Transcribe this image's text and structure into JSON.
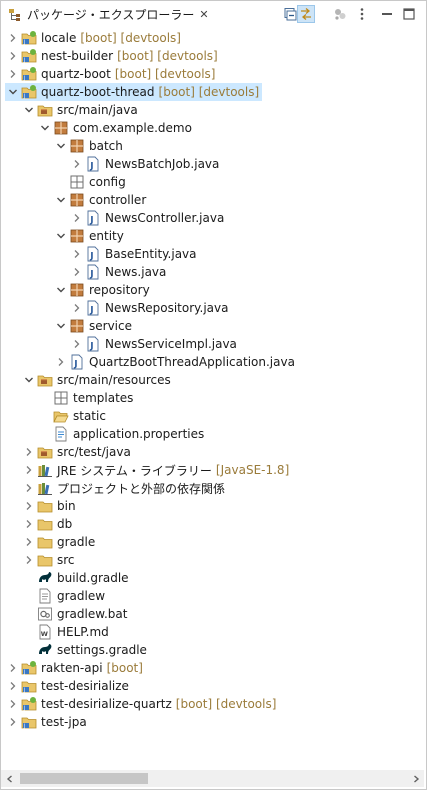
{
  "tab": {
    "title": "パッケージ・エクスプローラー",
    "close_glyph": "✕"
  },
  "toolbar": [
    {
      "name": "collapse-all-icon",
      "active": false
    },
    {
      "name": "link-with-editor-icon",
      "active": true
    },
    {
      "name": "focus-active-task-icon",
      "active": false
    },
    {
      "name": "view-menu-icon",
      "active": false
    },
    {
      "name": "minimize-icon",
      "active": false
    },
    {
      "name": "maximize-icon",
      "active": false
    }
  ],
  "tree": [
    {
      "level": 0,
      "twisty": "closed",
      "icon": "project-java-boot",
      "label": "locale",
      "dec": "[boot] [devtools]"
    },
    {
      "level": 0,
      "twisty": "closed",
      "icon": "project-java-boot",
      "label": "nest-builder",
      "dec": "[boot] [devtools]"
    },
    {
      "level": 0,
      "twisty": "closed",
      "icon": "project-java-boot",
      "label": "quartz-boot",
      "dec": "[boot] [devtools]"
    },
    {
      "level": 0,
      "twisty": "open",
      "icon": "project-java-boot",
      "label": "quartz-boot-thread",
      "dec": "[boot] [devtools]",
      "selected": true
    },
    {
      "level": 1,
      "twisty": "open",
      "icon": "source-folder",
      "label": "src/main/java"
    },
    {
      "level": 2,
      "twisty": "open",
      "icon": "package",
      "label": "com.example.demo"
    },
    {
      "level": 3,
      "twisty": "open",
      "icon": "package",
      "label": "batch"
    },
    {
      "level": 4,
      "twisty": "closed",
      "icon": "java-file",
      "label": "NewsBatchJob.java"
    },
    {
      "level": 3,
      "twisty": "none",
      "icon": "package-empty",
      "label": "config"
    },
    {
      "level": 3,
      "twisty": "open",
      "icon": "package",
      "label": "controller"
    },
    {
      "level": 4,
      "twisty": "closed",
      "icon": "java-file",
      "label": "NewsController.java"
    },
    {
      "level": 3,
      "twisty": "open",
      "icon": "package",
      "label": "entity"
    },
    {
      "level": 4,
      "twisty": "closed",
      "icon": "java-file",
      "label": "BaseEntity.java"
    },
    {
      "level": 4,
      "twisty": "closed",
      "icon": "java-file",
      "label": "News.java"
    },
    {
      "level": 3,
      "twisty": "open",
      "icon": "package",
      "label": "repository"
    },
    {
      "level": 4,
      "twisty": "closed",
      "icon": "java-file",
      "label": "NewsRepository.java"
    },
    {
      "level": 3,
      "twisty": "open",
      "icon": "package",
      "label": "service"
    },
    {
      "level": 4,
      "twisty": "closed",
      "icon": "java-file",
      "label": "NewsServiceImpl.java"
    },
    {
      "level": 3,
      "twisty": "closed",
      "icon": "java-file",
      "label": "QuartzBootThreadApplication.java"
    },
    {
      "level": 1,
      "twisty": "open",
      "icon": "source-folder",
      "label": "src/main/resources"
    },
    {
      "level": 2,
      "twisty": "none",
      "icon": "package-empty",
      "label": "templates"
    },
    {
      "level": 2,
      "twisty": "none",
      "icon": "folder-open",
      "label": "static"
    },
    {
      "level": 2,
      "twisty": "none",
      "icon": "properties-file",
      "label": "application.properties"
    },
    {
      "level": 1,
      "twisty": "closed",
      "icon": "source-folder",
      "label": "src/test/java"
    },
    {
      "level": 1,
      "twisty": "closed",
      "icon": "library",
      "label": "JRE システム・ライブラリー",
      "dec": "[JavaSE-1.8]"
    },
    {
      "level": 1,
      "twisty": "closed",
      "icon": "library",
      "label": "プロジェクトと外部の依存関係"
    },
    {
      "level": 1,
      "twisty": "closed",
      "icon": "folder",
      "label": "bin"
    },
    {
      "level": 1,
      "twisty": "closed",
      "icon": "folder",
      "label": "db"
    },
    {
      "level": 1,
      "twisty": "closed",
      "icon": "folder",
      "label": "gradle"
    },
    {
      "level": 1,
      "twisty": "closed",
      "icon": "folder",
      "label": "src"
    },
    {
      "level": 1,
      "twisty": "none",
      "icon": "gradle-file",
      "label": "build.gradle"
    },
    {
      "level": 1,
      "twisty": "none",
      "icon": "text-file",
      "label": "gradlew"
    },
    {
      "level": 1,
      "twisty": "none",
      "icon": "bat-file",
      "label": "gradlew.bat"
    },
    {
      "level": 1,
      "twisty": "none",
      "icon": "md-file",
      "label": "HELP.md"
    },
    {
      "level": 1,
      "twisty": "none",
      "icon": "gradle-file",
      "label": "settings.gradle"
    },
    {
      "level": 0,
      "twisty": "closed",
      "icon": "project-java-boot",
      "label": "rakten-api",
      "dec": "[boot]"
    },
    {
      "level": 0,
      "twisty": "closed",
      "icon": "project-java",
      "label": "test-desirialize"
    },
    {
      "level": 0,
      "twisty": "closed",
      "icon": "project-java-boot",
      "label": "test-desirialize-quartz",
      "dec": "[boot] [devtools]"
    },
    {
      "level": 0,
      "twisty": "closed",
      "icon": "project-java",
      "label": "test-jpa"
    }
  ],
  "scrollbar": {
    "position": 0
  }
}
